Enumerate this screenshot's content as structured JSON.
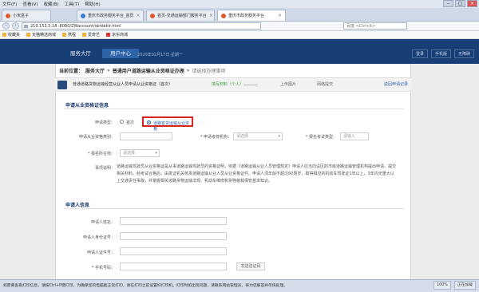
{
  "browser": {
    "menu": [
      "文件(F)",
      "查看(V)",
      "收藏(B)",
      "工具(T)",
      "帮助(H)"
    ],
    "tabs": [
      {
        "label": "小米盒子"
      },
      {
        "label": "重庆市政务服务平台_首页"
      },
      {
        "label": "首页-交通运输部门服务平台"
      },
      {
        "label": "重庆市政务服务平台"
      }
    ],
    "url": "219.153.5.18 :8080/ZWaccount/sbrdeklr.html",
    "search_placeholder": "百度 <Ctrl+K>",
    "bookmarks": [
      "收藏夹",
      "天猫精选商城",
      "携程",
      "爱奇艺",
      "京东商城"
    ]
  },
  "site": {
    "nav": [
      "服务大厅",
      "用户中心"
    ],
    "time_text": "2020年02月17日 星期一",
    "right_links": [
      "登录",
      "手机版",
      "无障碍"
    ]
  },
  "breadcrumb": {
    "prefix": "当前位置：",
    "home": "服务大厅",
    "sep": "»",
    "current": "普通用户道路运输从业资格证办理",
    "tail": "请选择办理事项"
  },
  "steps": {
    "item_title": "普通道路货物运输经营从业人员申请从业资格证（首次）",
    "step1": "填写材料（个人）",
    "step2": "上传图片",
    "step3": "网络提交",
    "back": "返回申请记录"
  },
  "section1": {
    "title": "申请从业资格证信息",
    "label_type": "申请类型：",
    "radio_a": "首次",
    "radio_b": "道路客货运输从业资格",
    "label_cert": "申请从业资格类别：",
    "cert_placeholder": "",
    "label_org": "* 申请考核机构：",
    "org_placeholder": "请选择",
    "label_exam": "* 报名考试类型：",
    "exam_placeholder": "请输入",
    "label_location": "* 报名所在地：",
    "location_placeholder": "请选择",
    "label_desc": "事项说明：",
    "desc": "道路运输驾驶员从业资格证是从事道路运输驾驶员的资格证明，依据《道路运输从业人员管理规定》申请人应当向设区的市级道路运输管理机构提出申请，提交相关材料。经考试合格后，由发证机关核发道路运输从业人员从业资格证件。申请人须年龄不超过60周岁，取得相应的机动车驾驶证1年以上，3年内无重大以上交通责任事故，并掌握相关道路货物运输法规、机动车维修和货物装载保管基本知识。"
  },
  "section2": {
    "title": "申请人信息",
    "label_name": "申请人姓名：",
    "label_id": "申请人身份证号：",
    "label_idtype": "申请人证件号：",
    "label_phone": "* 手机号码：",
    "sms_button": "发送验证码"
  },
  "statusbar": {
    "text": "如需要查看打印信息，请按Ctrl+P键打印，为确保您的电脑能正常打印，请在打印之前设置好打印机。打印时如出现问题，请联系网站管理员，将为您解答并尽快处理。",
    "right": [
      "100%",
      "正在加载"
    ]
  }
}
